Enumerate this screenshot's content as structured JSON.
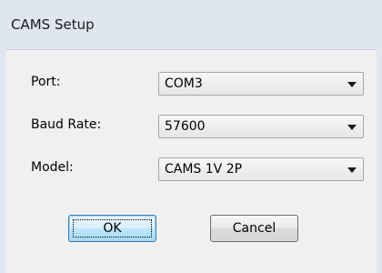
{
  "window": {
    "title": "CAMS Setup"
  },
  "form": {
    "port": {
      "label": "Port:",
      "value": "COM3"
    },
    "baud_rate": {
      "label": "Baud Rate:",
      "value": "57600"
    },
    "model": {
      "label": "Model:",
      "value": "CAMS 1V 2P"
    }
  },
  "buttons": {
    "ok_label": "OK",
    "cancel_label": "Cancel"
  },
  "colors": {
    "titlebar": "#dfe6ef",
    "client_background": "#f0f0f0",
    "default_button_border": "#3c7fb1"
  },
  "icons": {
    "dropdown": "chevron-down-icon"
  }
}
